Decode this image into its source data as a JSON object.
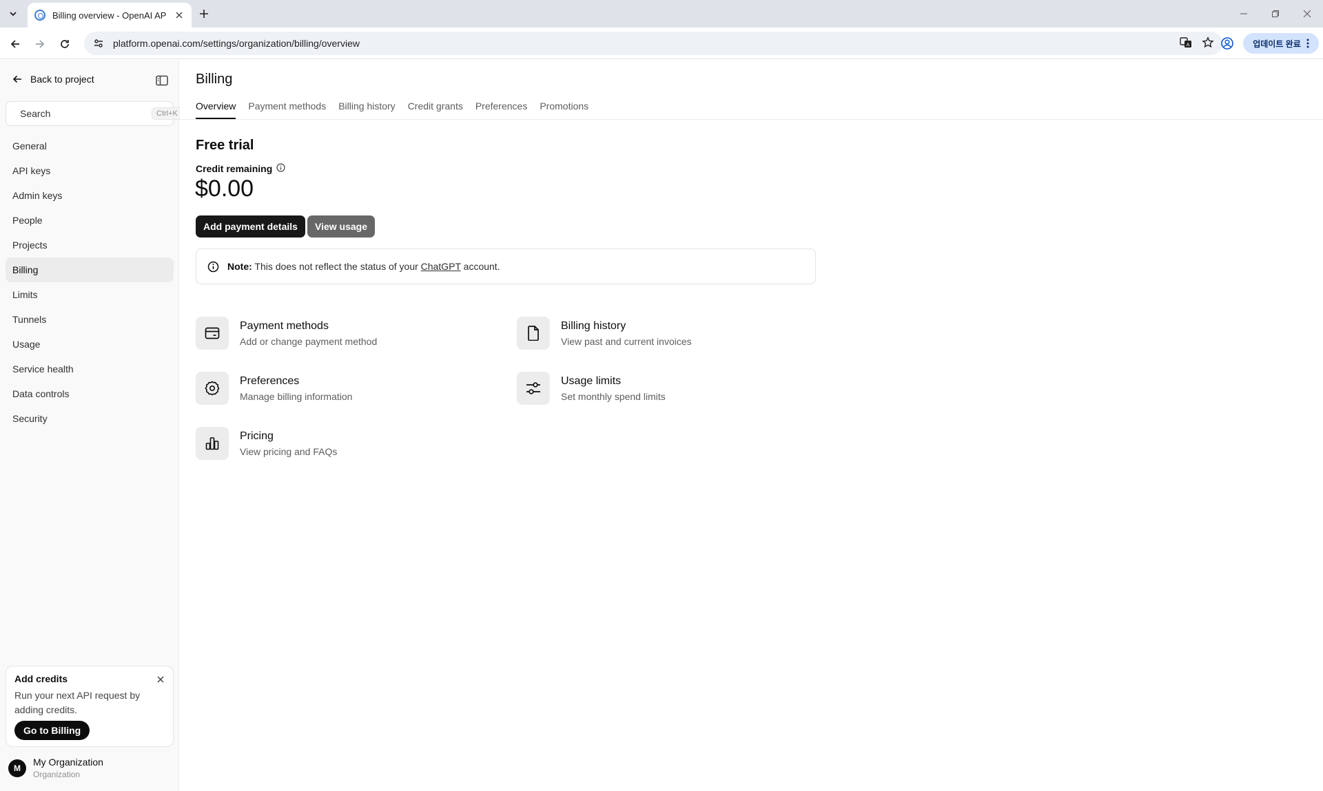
{
  "browser": {
    "tab_title": "Billing overview - OpenAI API",
    "url": "platform.openai.com/settings/organization/billing/overview",
    "update_label": "업데이트 완료"
  },
  "sidebar": {
    "back_label": "Back to project",
    "search_placeholder": "Search",
    "search_shortcut": "Ctrl+K",
    "items": [
      {
        "label": "General"
      },
      {
        "label": "API keys"
      },
      {
        "label": "Admin keys"
      },
      {
        "label": "People"
      },
      {
        "label": "Projects"
      },
      {
        "label": "Billing"
      },
      {
        "label": "Limits"
      },
      {
        "label": "Tunnels"
      },
      {
        "label": "Usage"
      },
      {
        "label": "Service health"
      },
      {
        "label": "Data controls"
      },
      {
        "label": "Security"
      }
    ],
    "active_item": "Billing",
    "promo": {
      "title": "Add credits",
      "text": "Run your next API request by adding credits.",
      "button": "Go to Billing"
    },
    "org": {
      "initial": "M",
      "name": "My Organization",
      "subtitle": "Organization"
    }
  },
  "main": {
    "title": "Billing",
    "tabs": [
      {
        "label": "Overview"
      },
      {
        "label": "Payment methods"
      },
      {
        "label": "Billing history"
      },
      {
        "label": "Credit grants"
      },
      {
        "label": "Preferences"
      },
      {
        "label": "Promotions"
      }
    ],
    "active_tab": "Overview",
    "plan_title": "Free trial",
    "credit_label": "Credit remaining",
    "credit_amount": "$0.00",
    "add_payment_label": "Add payment details",
    "view_usage_label": "View usage",
    "note": {
      "prefix": "Note:",
      "text": " This does not reflect the status of your ",
      "link": "ChatGPT",
      "suffix": " account."
    },
    "cards": [
      {
        "title": "Payment methods",
        "subtitle": "Add or change payment method",
        "icon": "credit-card-icon"
      },
      {
        "title": "Billing history",
        "subtitle": "View past and current invoices",
        "icon": "document-icon"
      },
      {
        "title": "Preferences",
        "subtitle": "Manage billing information",
        "icon": "gear-icon"
      },
      {
        "title": "Usage limits",
        "subtitle": "Set monthly spend limits",
        "icon": "sliders-icon"
      },
      {
        "title": "Pricing",
        "subtitle": "View pricing and FAQs",
        "icon": "bar-chart-icon"
      }
    ]
  },
  "colors": {
    "primary_button": "#181818",
    "secondary_button": "#676767",
    "sidebar_bg": "#f9f9f9",
    "active_item_bg": "#ececec"
  }
}
